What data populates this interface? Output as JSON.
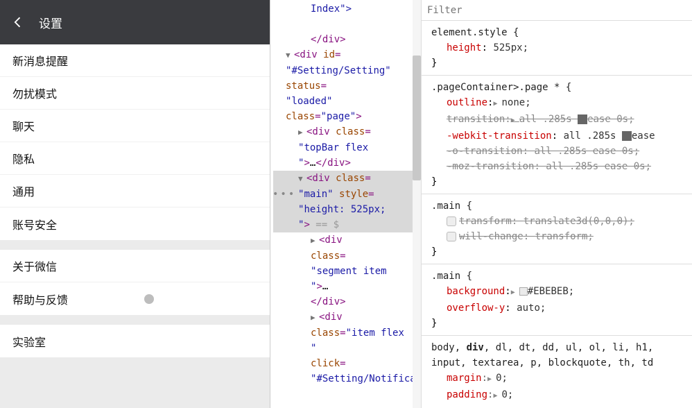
{
  "app": {
    "title": "设置",
    "segments": [
      {
        "items": [
          {
            "label": "新消息提醒"
          },
          {
            "label": "勿扰模式"
          },
          {
            "label": "聊天"
          },
          {
            "label": "隐私"
          },
          {
            "label": "通用"
          },
          {
            "label": "账号安全"
          }
        ]
      },
      {
        "items": [
          {
            "label": "关于微信"
          },
          {
            "label": "帮助与反馈",
            "dot": true
          }
        ]
      },
      {
        "items": [
          {
            "label": "实验室"
          }
        ]
      }
    ]
  },
  "dom": {
    "index_text": "Index\">",
    "close_div": "</div>",
    "div_id_attr": "id",
    "div_id_val": "#Setting/Setting",
    "status_attr": "status",
    "status_val": "loaded",
    "class_attr": "class",
    "class_page": "page",
    "class_topbar": "topBar flex",
    "ellipsis": "…",
    "class_main": "main",
    "style_attr": "style",
    "style_val": "height: 525px;",
    "eq_dollar": " == $",
    "class_segment": "segment item",
    "class_itemflex": "item flex",
    "click_attr": "click",
    "click_val": "#Setting/Notificati"
  },
  "styles": {
    "filter_placeholder": "Filter",
    "rule1": {
      "selector": "element.style {",
      "p1_name": "height",
      "p1_val": "525px;",
      "close": "}"
    },
    "rule2": {
      "selector": ".pageContainer>.page * {",
      "p1_name": "outline",
      "p1_val": "none;",
      "p2_name": "transition",
      "p2_val": "all .285s",
      "p2_tail": "ease 0s;",
      "p3_name": "-webkit-transition",
      "p3_val": "all .285s",
      "p3_tail": "ease",
      "p4_name": "-o-transition",
      "p4_val": "all .285s ease 0s;",
      "p5_name": "-moz-transition",
      "p5_val": "all .285s ease 0s;",
      "close": "}"
    },
    "rule3": {
      "selector": ".main {",
      "p1_name": "transform",
      "p1_val": "translate3d(0,0,0);",
      "p2_name": "will-change",
      "p2_val": "transform;",
      "close": "}"
    },
    "rule4": {
      "selector": ".main {",
      "p1_name": "background",
      "p1_val": "#EBEBEB;",
      "p2_name": "overflow-y",
      "p2_val": "auto;",
      "close": "}"
    },
    "rule5": {
      "selector": "body, div, dl, dt, dd, ul, ol, li, h1,",
      "selector2": "input, textarea, p, blockquote, th, td",
      "p1_name": "margin",
      "p1_val": "0;",
      "p2_name": "padding",
      "p2_val": "0;"
    }
  }
}
